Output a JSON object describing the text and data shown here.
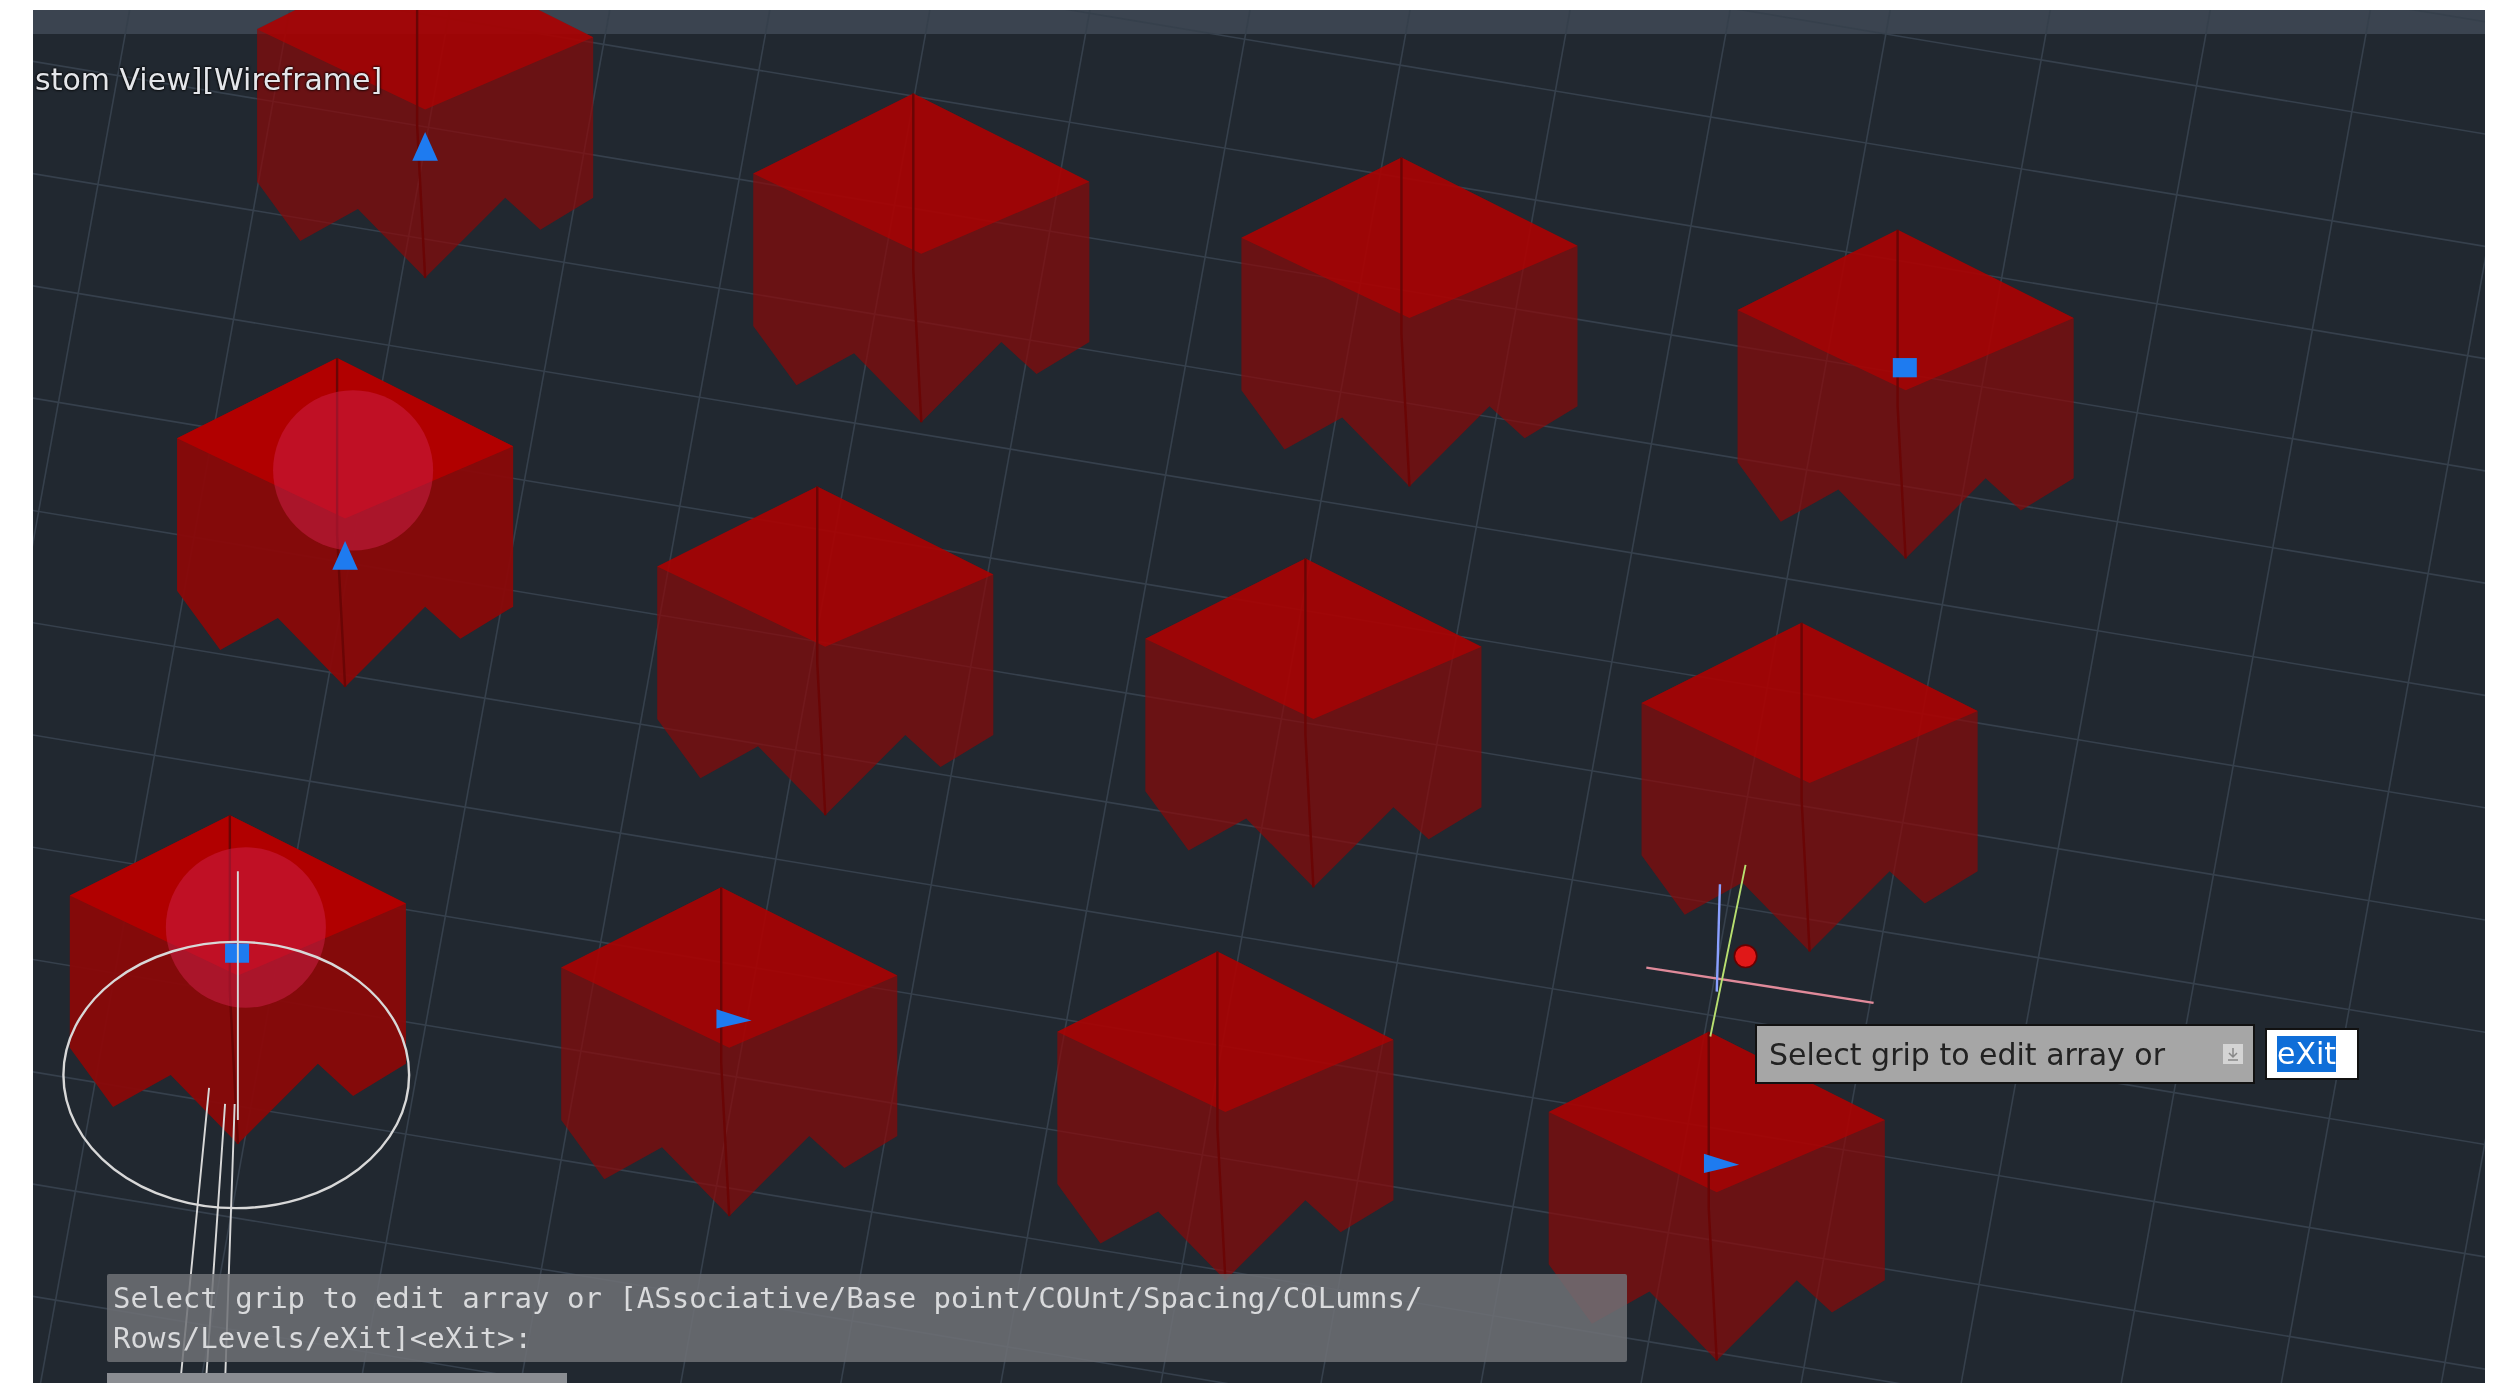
{
  "viewport": {
    "label": "stom View][Wireframe]"
  },
  "grip_tooltip": {
    "prompt": "Select grip to edit array or",
    "option": "eXit"
  },
  "command_line": {
    "lines": [
      "Select grip to edit array or [ASsociative/Base point/COUnt/Spacing/COLumns/",
      "Rows/Levels/eXit]<eXit>:"
    ]
  }
}
